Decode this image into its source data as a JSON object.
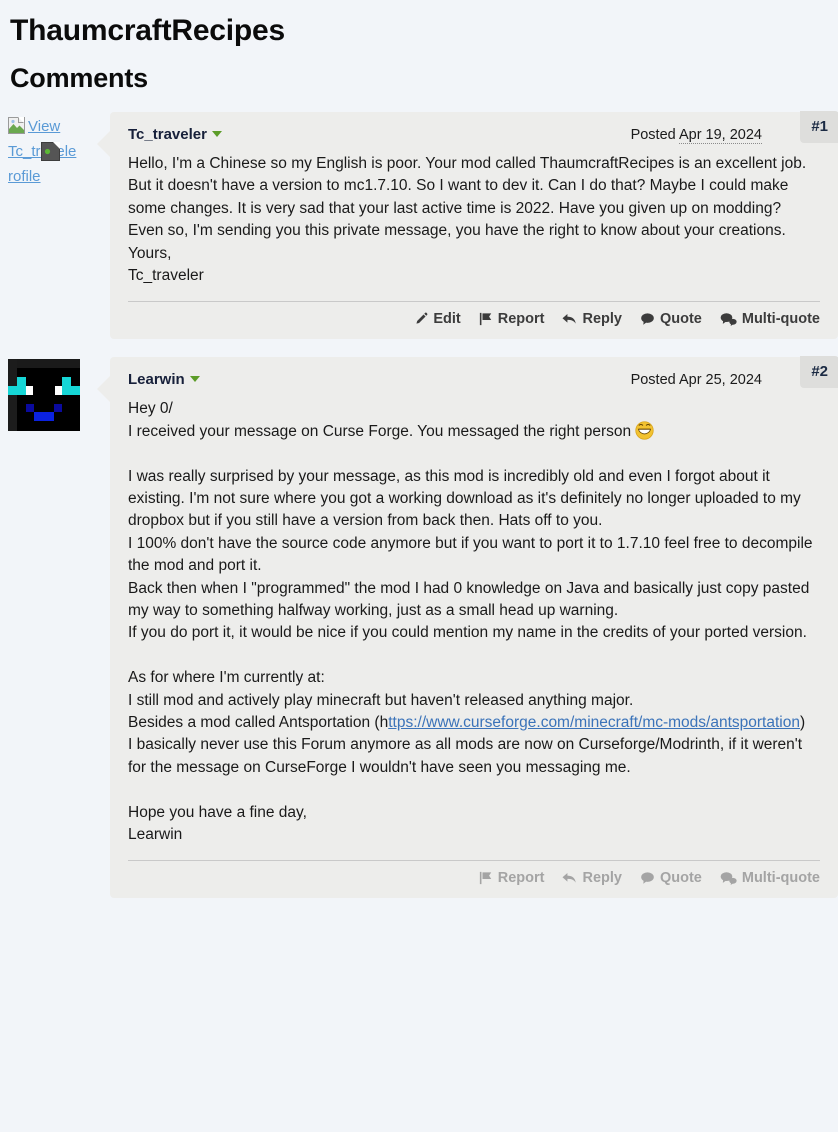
{
  "page": {
    "title": "ThaumcraftRecipes",
    "section_heading": "Comments",
    "background_color": "#f2f5f9",
    "bubble_color": "#ededeb",
    "accent_link_color": "#3b73b9",
    "caret_color": "#5c9c28",
    "post_badge_color": "#dededc"
  },
  "comments": [
    {
      "post_number": "#1",
      "author": "Tc_traveler",
      "avatar_type": "broken-image",
      "avatar_alt": "View Tc_traveler's Profile",
      "avatar_alt_visible": "View Tc_travele      rofile",
      "posted_label": "Posted",
      "posted_date": "Apr 19, 2024",
      "date_dotted_underline": true,
      "body": "Hello, I'm a Chinese so my English is poor. Your mod called ThaumcraftRecipes is an excellent job. But it doesn't have a version to mc1.7.10. So I want to dev it. Can I do that? Maybe I could make some changes. It is very sad that your last active time is 2022. Have you given up on modding? Even so, I'm sending you this private message, you have the right to know about your creations.\nYours,\nTc_traveler",
      "actions_muted": false,
      "actions": [
        {
          "icon": "pencil-icon",
          "label": "Edit"
        },
        {
          "icon": "flag-icon",
          "label": "Report"
        },
        {
          "icon": "reply-arrow-icon",
          "label": "Reply"
        },
        {
          "icon": "speech-bubble-icon",
          "label": "Quote"
        },
        {
          "icon": "double-speech-bubble-icon",
          "label": "Multi-quote"
        }
      ]
    },
    {
      "post_number": "#2",
      "author": "Learwin",
      "avatar_type": "minecraft-skin",
      "avatar_alt": "Learwin avatar",
      "posted_label": "Posted",
      "posted_date": "Apr 25, 2024",
      "date_dotted_underline": false,
      "body_part_1": "Hey 0/\nI received your message on Curse Forge. You messaged the right person ",
      "body_emoji": "grinning-face",
      "body_part_2": "\n\nI was really surprised by your message, as this mod is incredibly old and even I forgot about it existing. I'm not sure where you got a working download as it's definitely no longer uploaded to my dropbox but if you still have a version from back then. Hats off to you.\nI 100% don't have the source code anymore but if you want to port it to 1.7.10 feel free to decompile the mod and port it.\nBack then when I \"programmed\" the mod I had 0 knowledge on Java and basically just copy pasted my way to something halfway working, just as a small head up warning.\nIf you do port it, it would be nice if you could mention my name in the credits of your ported version.\n\nAs for where I'm currently at:\nI still mod and actively play minecraft but haven't released anything major.\nBesides a mod called Antsportation (h",
      "body_link_text": "ttps://www.curseforge.com/minecraft/mc-mods/antsportation",
      "body_part_3": ")\nI basically never use this Forum anymore as all mods are now on Curseforge/Modrinth, if it weren't for the message on CurseForge I wouldn't have seen you messaging me.\n\nHope you have a fine day,\nLearwin",
      "actions_muted": true,
      "actions": [
        {
          "icon": "flag-icon",
          "label": "Report"
        },
        {
          "icon": "reply-arrow-icon",
          "label": "Reply"
        },
        {
          "icon": "speech-bubble-icon",
          "label": "Quote"
        },
        {
          "icon": "double-speech-bubble-icon",
          "label": "Multi-quote"
        }
      ]
    }
  ]
}
